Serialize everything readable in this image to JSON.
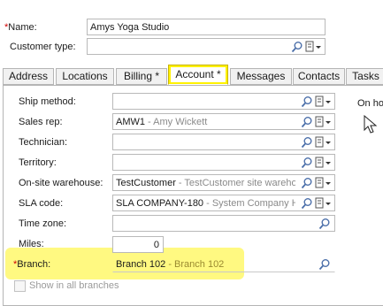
{
  "header": {
    "name_label_required_mark": "*",
    "name_label": "Name:",
    "name_value": "Amys Yoga Studio",
    "customer_type_label": "Customer type:",
    "customer_type_value": ""
  },
  "tabs": [
    {
      "label": "Address",
      "active": false
    },
    {
      "label": "Locations",
      "active": false
    },
    {
      "label": "Billing *",
      "active": false
    },
    {
      "label": "Account *",
      "active": true
    },
    {
      "label": "Messages",
      "active": false
    },
    {
      "label": "Contacts",
      "active": false
    },
    {
      "label": "Tasks",
      "active": false
    }
  ],
  "account": {
    "ship_method": {
      "label": "Ship method:",
      "code": "",
      "desc": ""
    },
    "sales_rep": {
      "label": "Sales rep:",
      "code": "AMW1",
      "desc": " - Amy Wickett"
    },
    "technician": {
      "label": "Technician:",
      "code": "",
      "desc": ""
    },
    "territory": {
      "label": "Territory:",
      "code": "",
      "desc": ""
    },
    "onsite_warehouse": {
      "label": "On-site warehouse:",
      "code": "TestCustomer",
      "desc": " - TestCustomer site warehouse"
    },
    "sla_code": {
      "label": "SLA code:",
      "code": "SLA COMPANY-180",
      "desc": " - System Company Hours"
    },
    "time_zone": {
      "label": "Time zone:",
      "code": "",
      "desc": ""
    },
    "miles": {
      "label": "Miles:",
      "value": "0"
    },
    "branch": {
      "required_mark": "*",
      "label": "Branch:",
      "code": "Branch 102",
      "desc": " - Branch 102"
    },
    "show_all_branches": {
      "label": "Show in all branches",
      "checked": false
    }
  },
  "right_panel": {
    "text": "On ho"
  },
  "colors": {
    "highlight": "#fff86b",
    "required": "#d00000",
    "description_gray": "#8a8a8a"
  }
}
